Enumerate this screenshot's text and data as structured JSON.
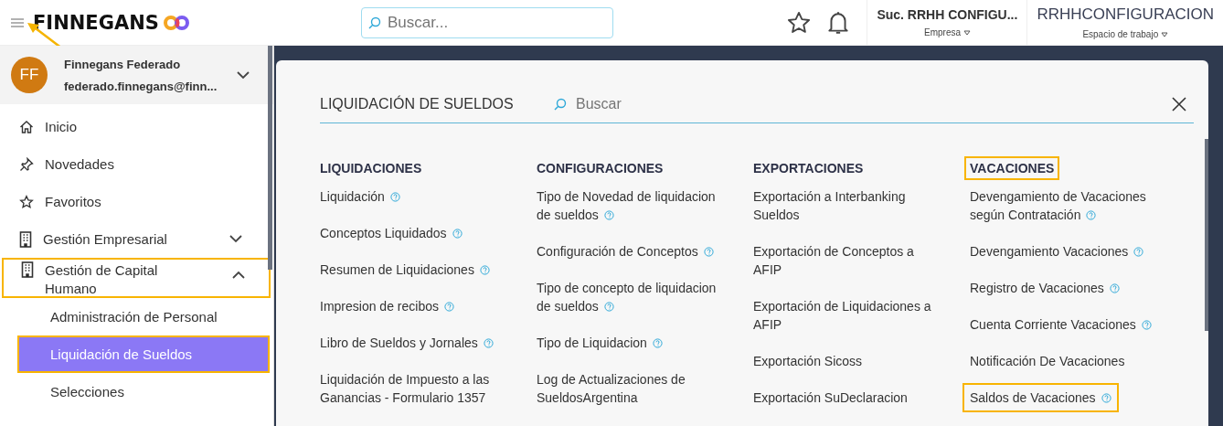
{
  "header": {
    "brand": "FINNEGANS",
    "menu_annotated": true,
    "search": {
      "placeholder": "Buscar..."
    },
    "company": {
      "value": "Suc. RRHH CONFIGU...",
      "label": "Empresa"
    },
    "workspace": {
      "value": "RRHHCONFIGURACION",
      "label": "Espacio de trabajo"
    }
  },
  "user": {
    "initials": "FF",
    "name": "Finnegans Federado",
    "email": "federado.finnegans@finn..."
  },
  "sidebar": {
    "items": [
      {
        "kind": "home",
        "label": "Inicio",
        "highlighted": false
      },
      {
        "kind": "pin",
        "label": "Novedades",
        "highlighted": false
      },
      {
        "kind": "star",
        "label": "Favoritos",
        "highlighted": false
      },
      {
        "kind": "group",
        "label": "Gestión Empresarial",
        "expanded": false,
        "highlighted": false
      },
      {
        "kind": "group",
        "label": "Gestión de Capital Humano",
        "expanded": true,
        "highlighted": true,
        "children": [
          {
            "label": "Administración de Personal",
            "selected": false,
            "highlighted": false
          },
          {
            "label": "Liquidación de Sueldos",
            "selected": true,
            "highlighted": true
          },
          {
            "label": "Selecciones",
            "selected": false,
            "highlighted": false
          }
        ]
      }
    ]
  },
  "panel": {
    "title": "LIQUIDACIÓN DE SUELDOS",
    "search": {
      "placeholder": "Buscar"
    },
    "columns": [
      {
        "heading": "LIQUIDACIONES",
        "highlighted": false,
        "items": [
          {
            "label": "Liquidación",
            "help": true,
            "highlighted": false
          },
          {
            "label": "Conceptos Liquidados",
            "help": true,
            "highlighted": false
          },
          {
            "label": "Resumen de Liquidaciones",
            "help": true,
            "highlighted": false
          },
          {
            "label": "Impresion de recibos",
            "help": true,
            "highlighted": false
          },
          {
            "label": "Libro de Sueldos y Jornales",
            "help": true,
            "highlighted": false
          },
          {
            "label": "Liquidación de Impuesto a las Ganancias - Formulario 1357",
            "help": false,
            "highlighted": false
          }
        ]
      },
      {
        "heading": "CONFIGURACIONES",
        "highlighted": false,
        "items": [
          {
            "label": "Tipo de Novedad de liquidacion de sueldos",
            "help": true,
            "highlighted": false
          },
          {
            "label": "Configuración de Conceptos",
            "help": true,
            "highlighted": false
          },
          {
            "label": "Tipo de concepto de liquidacion de sueldos",
            "help": true,
            "highlighted": false
          },
          {
            "label": "Tipo de Liquidacion",
            "help": true,
            "highlighted": false
          },
          {
            "label": "Log de Actualizaciones de SueldosArgentina",
            "help": false,
            "highlighted": false
          }
        ]
      },
      {
        "heading": "EXPORTACIONES",
        "highlighted": false,
        "items": [
          {
            "label": "Exportación a Interbanking Sueldos",
            "help": false,
            "highlighted": false
          },
          {
            "label": "Exportación de Conceptos a AFIP",
            "help": false,
            "highlighted": false
          },
          {
            "label": "Exportación de Liquidaciones a AFIP",
            "help": false,
            "highlighted": false
          },
          {
            "label": "Exportación Sicoss",
            "help": false,
            "highlighted": false
          },
          {
            "label": "Exportación SuDeclaracion",
            "help": false,
            "highlighted": false
          }
        ]
      },
      {
        "heading": "VACACIONES",
        "highlighted": true,
        "items": [
          {
            "label": "Devengamiento de Vacaciones según Contratación",
            "help": true,
            "highlighted": false
          },
          {
            "label": "Devengamiento Vacaciones",
            "help": true,
            "highlighted": false
          },
          {
            "label": "Registro de Vacaciones",
            "help": true,
            "highlighted": false
          },
          {
            "label": "Cuenta Corriente Vacaciones",
            "help": true,
            "highlighted": false
          },
          {
            "label": "Notificación De Vacaciones",
            "help": false,
            "highlighted": false
          },
          {
            "label": "Saldos de Vacaciones",
            "help": true,
            "highlighted": true
          }
        ]
      }
    ]
  }
}
